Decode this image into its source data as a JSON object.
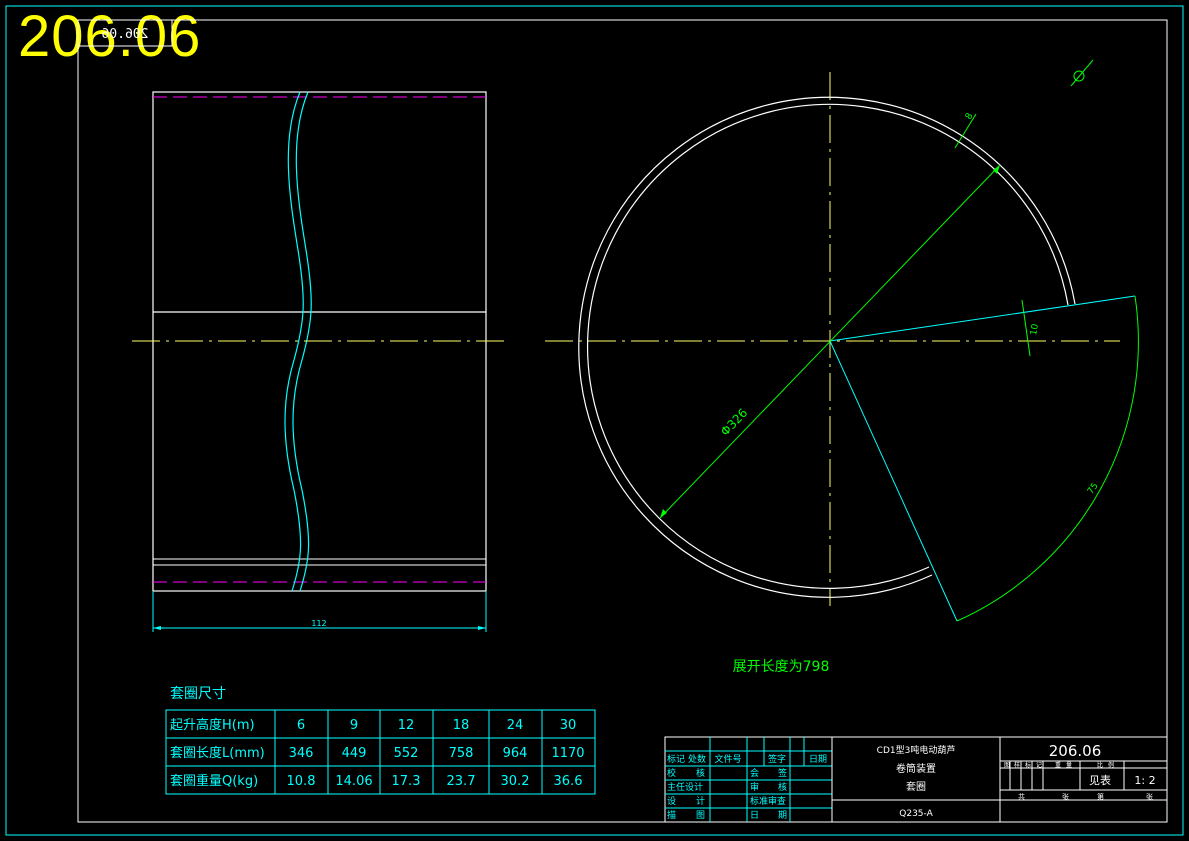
{
  "drawing_number_large": "206.06",
  "drawing_number_mirrored": "206.06",
  "colors": {
    "white": "#ffffff",
    "cyan": "#00ffff",
    "green": "#00ff00",
    "yellow": "#ffff00",
    "magenta": "#ff00ff",
    "centerline": "#ffff66"
  },
  "dimensions": {
    "width_label": "112",
    "diameter_label": "Φ326",
    "thickness_label": "8",
    "gap_label": "10",
    "arc_label": "75"
  },
  "unfold_note": "展开长度为798",
  "surface_symbol": "∅",
  "dim_table": {
    "title": "套圈尺寸",
    "rows": [
      {
        "label": "起升高度H(m)",
        "values": [
          "6",
          "9",
          "12",
          "18",
          "24",
          "30"
        ]
      },
      {
        "label": "套圈长度L(mm)",
        "values": [
          "346",
          "449",
          "552",
          "758",
          "964",
          "1170"
        ]
      },
      {
        "label": "套圈重量Q(kg)",
        "values": [
          "10.8",
          "14.06",
          "17.3",
          "23.7",
          "30.2",
          "36.6"
        ]
      }
    ]
  },
  "title_block": {
    "headers": [
      "标记",
      "处数",
      "文件号",
      "签字",
      "日期"
    ],
    "left_labels": [
      [
        "校",
        "核",
        "会",
        "签"
      ],
      [
        "主任设计",
        "",
        "审",
        "核"
      ],
      [
        "设",
        "计",
        "标准审查",
        ""
      ],
      [
        "描",
        "图",
        "日",
        "期"
      ]
    ],
    "product_line1": "CD1型3吨电动葫芦",
    "product_line2": "卷筒装置",
    "product_line3": "套圈",
    "material": "Q235-A",
    "drawing_no": "206.06",
    "sub_headers": [
      "图",
      "样",
      "标",
      "记",
      "重",
      "量",
      "比",
      "例"
    ],
    "weight_value": "见表",
    "scale_value": "1: 2",
    "bottom_labels": [
      "共",
      "张",
      "第",
      "张"
    ]
  }
}
